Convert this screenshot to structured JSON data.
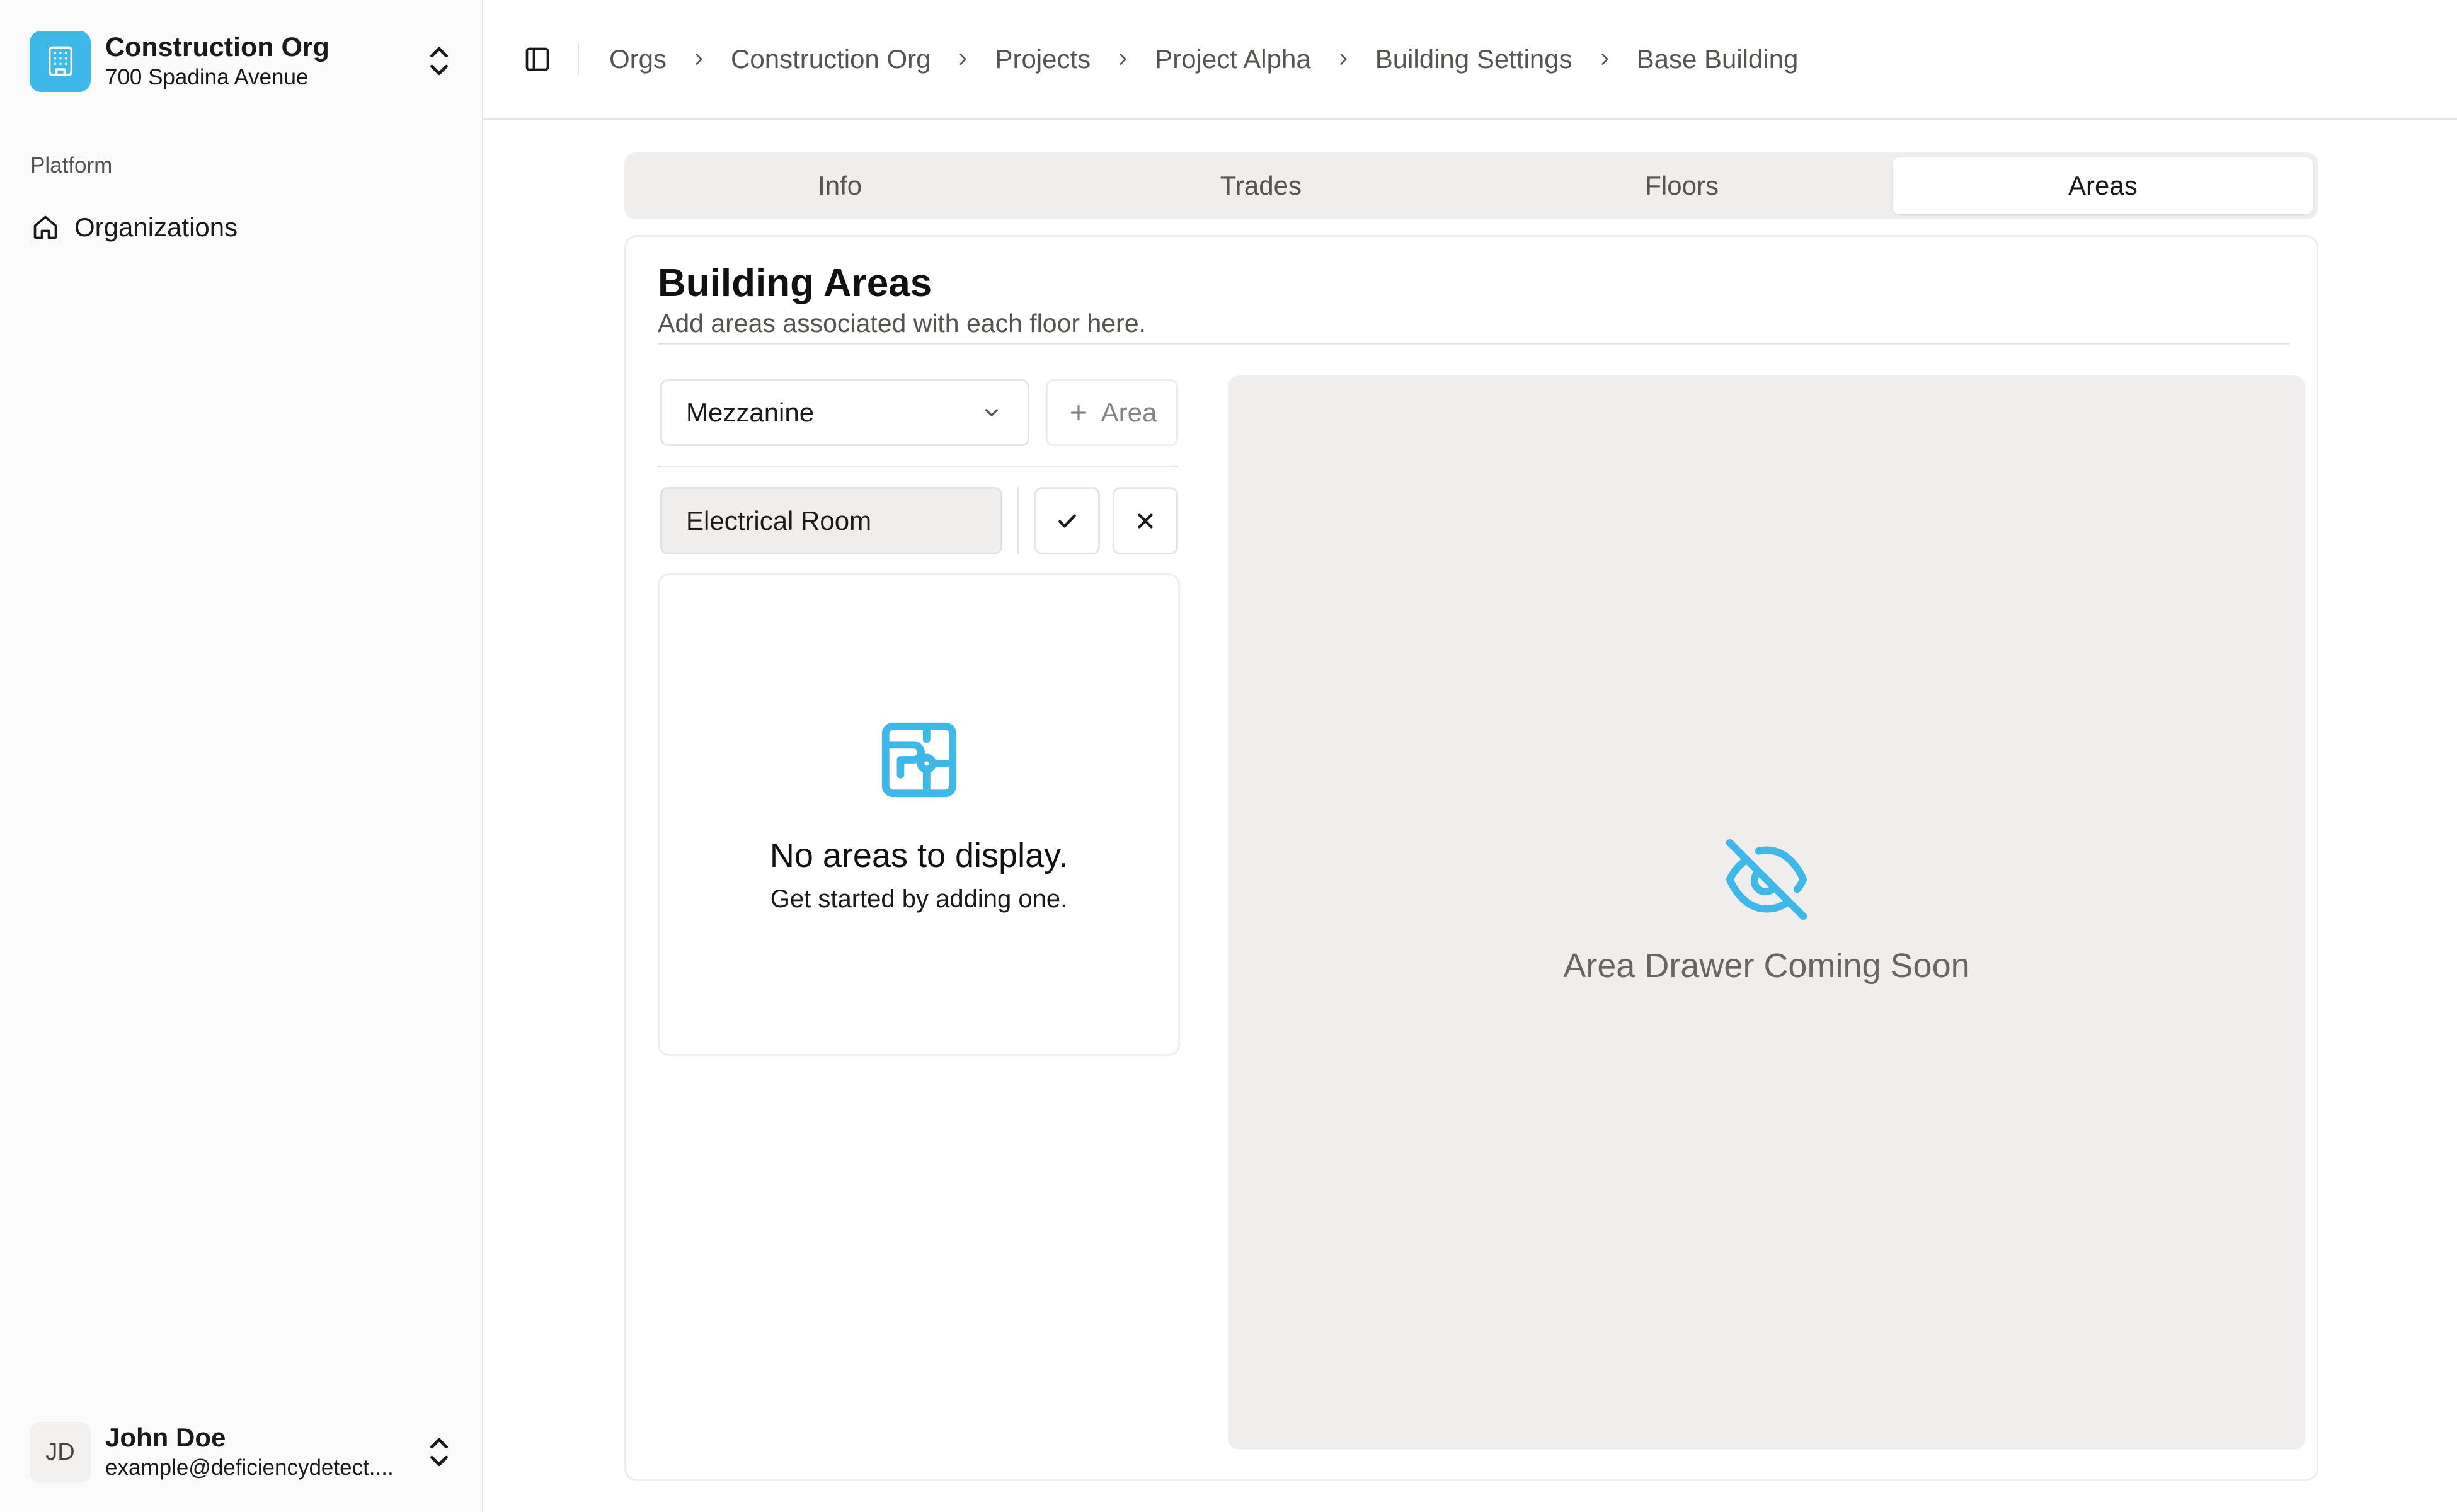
{
  "colors": {
    "accent": "#3db8e8",
    "muted_bg": "#efeeed",
    "border": "#e7e5e4"
  },
  "sidebar": {
    "org": {
      "name": "Construction Org",
      "address": "700 Spadina Avenue",
      "icon": "building-icon"
    },
    "section_label": "Platform",
    "items": [
      {
        "label": "Organizations",
        "icon": "home-icon"
      }
    ],
    "user": {
      "initials": "JD",
      "name": "John Doe",
      "email": "example@deficiencydetect...."
    }
  },
  "breadcrumbs": [
    "Orgs",
    "Construction Org",
    "Projects",
    "Project Alpha",
    "Building Settings",
    "Base Building"
  ],
  "tabs": [
    {
      "label": "Info",
      "active": false
    },
    {
      "label": "Trades",
      "active": false
    },
    {
      "label": "Floors",
      "active": false
    },
    {
      "label": "Areas",
      "active": true
    }
  ],
  "card": {
    "title": "Building Areas",
    "description": "Add areas associated with each floor here.",
    "floor_select": {
      "value": "Mezzanine"
    },
    "add_area_label": "Area",
    "area_input": {
      "value": "Electrical Room",
      "placeholder": ""
    },
    "empty_state": {
      "title": "No areas to display.",
      "subtitle": "Get started by adding one.",
      "icon": "floorplan-icon"
    },
    "drawer": {
      "text": "Area Drawer Coming Soon",
      "icon": "eye-off-icon"
    }
  }
}
